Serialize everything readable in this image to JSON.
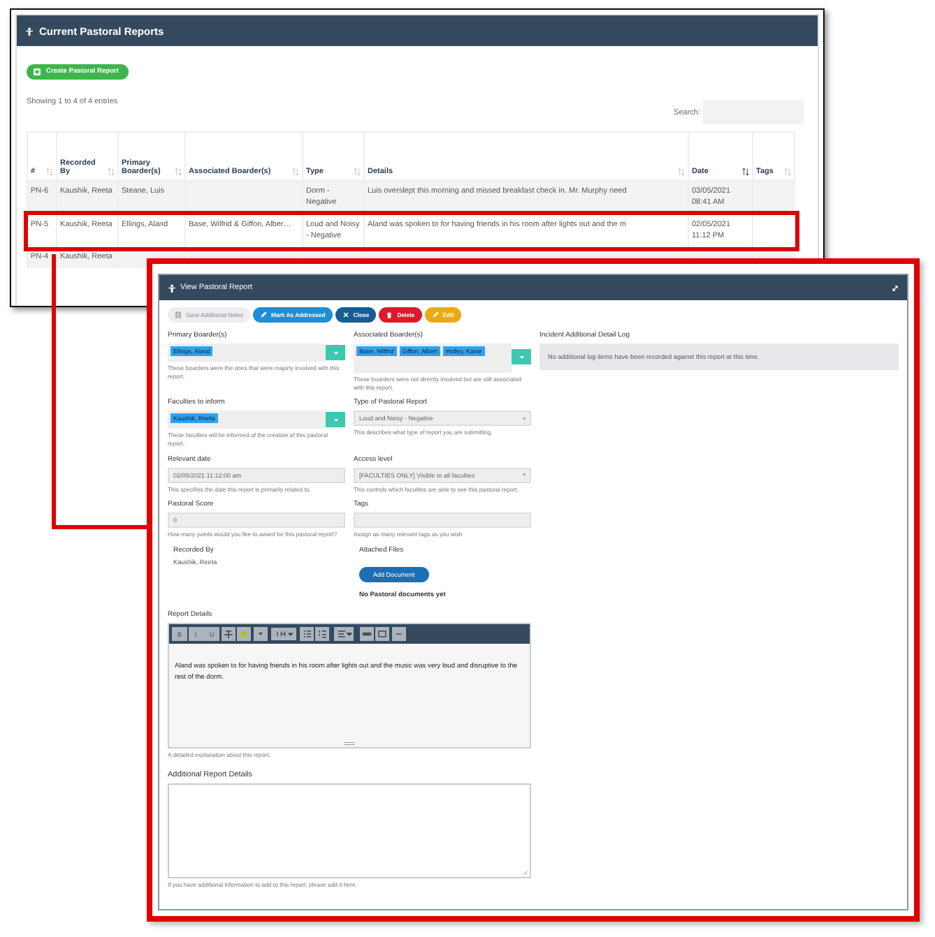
{
  "back_window": {
    "title": "Current Pastoral Reports",
    "create_button": "Create Pastoral Report",
    "showing": "Showing 1 to 4 of 4 entries",
    "search_label": "Search:",
    "columns": [
      {
        "label": "#",
        "sorted": false
      },
      {
        "label": "Recorded By",
        "sorted": false
      },
      {
        "label": "Primary Boarder(s)",
        "sorted": false
      },
      {
        "label": "Associated Boarder(s)",
        "sorted": false
      },
      {
        "label": "Type",
        "sorted": false
      },
      {
        "label": "Details",
        "sorted": false
      },
      {
        "label": "Date",
        "sorted": true
      },
      {
        "label": "Tags",
        "sorted": false
      }
    ],
    "rows": [
      {
        "striped": true,
        "highlighted": false,
        "cells": [
          "PN-6",
          "Kaushik, Reeta",
          "Steane, Luis",
          "",
          "Dorm - Negative",
          "Luis overslept this morning and missed breakfast check in. Mr. Murphy need",
          "03/05/2021 08:41 AM",
          ""
        ]
      },
      {
        "striped": false,
        "highlighted": true,
        "cells": [
          "PN-5",
          "Kaushik, Reeta",
          "Ellings, Aland",
          "Base, Wilfrid & Giffon, Alber…",
          "Loud and Noisy - Negative",
          "Aland was spoken to for having friends in his room after lights out and the m",
          "02/05/2021 11:12 PM",
          ""
        ]
      },
      {
        "striped": true,
        "highlighted": false,
        "cells": [
          "PN-4",
          "Kaushik, Reeta",
          "",
          "",
          "",
          "",
          "",
          ""
        ]
      }
    ]
  },
  "front_window": {
    "title": "View Pastoral Report",
    "actions": [
      {
        "kind": "save",
        "label": "Save Additional Notes"
      },
      {
        "kind": "mark",
        "label": "Mark As Addressed"
      },
      {
        "kind": "close",
        "label": "Close"
      },
      {
        "kind": "delete",
        "label": "Delete"
      },
      {
        "kind": "edit",
        "label": "Edit"
      }
    ],
    "fields": [
      {
        "kind": "tags",
        "label": "Primary Boarder(s)",
        "tags": [
          "Ellings, Aland"
        ],
        "help": "These boarders were the ones that were majorly involved with this report."
      },
      {
        "kind": "tags",
        "label": "Associated Boarder(s)",
        "tags": [
          "Base, Wilfrid",
          "Giffon, Albert",
          "Hotley, Kaine"
        ],
        "help": "These boarders were not directly involved but are still associated with this report."
      },
      {
        "kind": "tags",
        "label": "Faculties to inform",
        "tags": [
          "Kaushik, Reeta"
        ],
        "help": "These faculties will be informed of the creation of this pastoral report."
      },
      {
        "kind": "select",
        "label": "Type of Pastoral Report",
        "value": "Loud and Noisy - Negative",
        "help": "This describes what type of report you are submitting."
      },
      {
        "kind": "input",
        "label": "Relevant date",
        "value": "02/05/2021 11:12:00 am",
        "help": "This specifies the date this report is primarily related to."
      },
      {
        "kind": "select",
        "label": "Access level",
        "value": "[FACULTIES ONLY] Visible to all faculties",
        "help": "This controls which faculties are able to see this pastoral report."
      },
      {
        "kind": "input",
        "label": "Pastoral Score",
        "value": "0",
        "help": "How many points would you like to award for this pastoral report?"
      },
      {
        "kind": "input",
        "label": "Tags",
        "help": "Assign as many relevant tags as you wish"
      },
      {
        "kind": "text",
        "label": "Recorded By",
        "value": "Kaushik, Reeta"
      },
      {
        "kind": "files",
        "label": "Attached Files",
        "button": "Add Document",
        "empty": "No Pastoral documents yet"
      }
    ],
    "log": {
      "label": "Incident Additional Detail Log",
      "message": "No additional log items have been recorded against this report at this time."
    },
    "report_details": {
      "label": "Report Details",
      "toolbar": [
        [
          {
            "kind": "text",
            "label": "B"
          },
          {
            "kind": "text",
            "label": "I"
          },
          {
            "kind": "text",
            "label": "U"
          },
          {
            "kind": "strikethrough"
          },
          {
            "kind": "highlight"
          },
          {
            "kind": "dropdown"
          }
        ],
        [
          {
            "kind": "font-size"
          }
        ],
        [
          {
            "kind": "bullet-list"
          },
          {
            "kind": "numbered-list"
          },
          {
            "kind": "align"
          }
        ],
        [
          {
            "kind": "link"
          },
          {
            "kind": "picture"
          },
          {
            "kind": "rule"
          }
        ]
      ],
      "text": "Aland was spoken to for having friends in his room after lights out and the music was very loud and disruptive to the rest of the dorm.",
      "help": "A detailed explanation about this report."
    },
    "additional_details": {
      "label": "Additional Report Details",
      "help": "If you have additional information to add to this report, please add it here."
    }
  }
}
